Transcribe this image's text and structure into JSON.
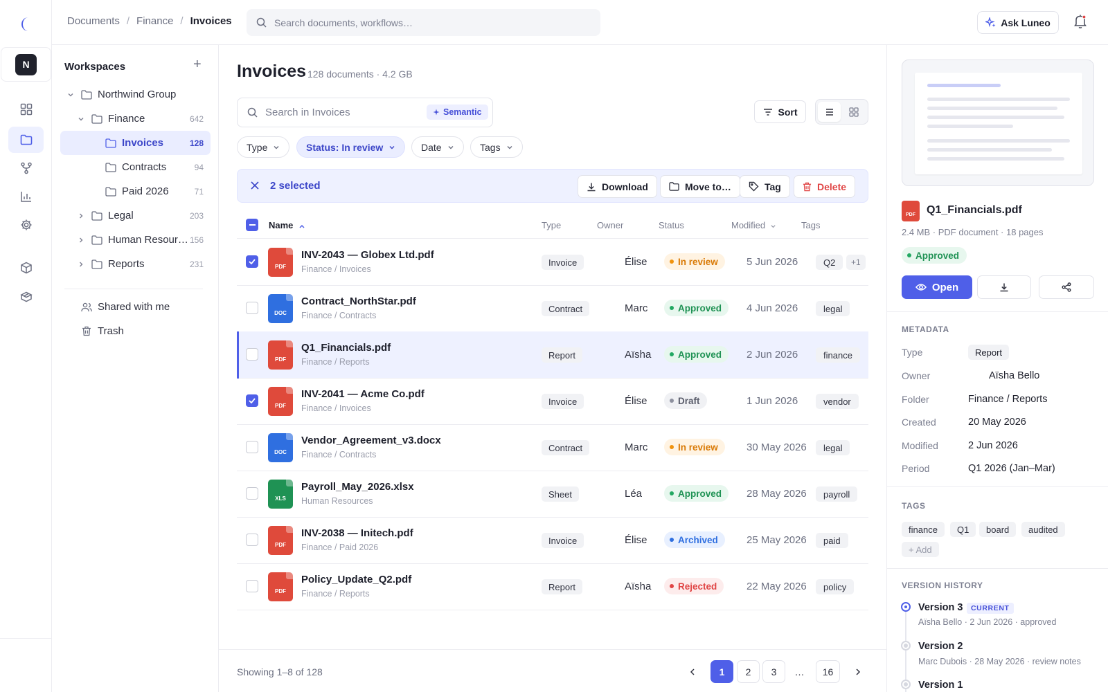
{
  "rail": {
    "avatar_initial": "N",
    "icons": [
      "grid-icon",
      "folder-icon",
      "workflow-icon",
      "chart-icon",
      "gear-icon",
      "cube-icon",
      "box-icon"
    ]
  },
  "topbar": {
    "breadcrumb": [
      "Documents",
      "Finance",
      "Invoices"
    ],
    "breadcrumb_sep": "/",
    "search_placeholder": "Search documents, workflows…",
    "ask_label": "Ask Luneo"
  },
  "workspaces": {
    "title": "Workspaces",
    "add": "+",
    "tree": [
      {
        "label": "Northwind Group",
        "count": ""
      },
      {
        "label": "Finance",
        "count": "642"
      },
      {
        "label": "Invoices",
        "count": "128"
      },
      {
        "label": "Contracts",
        "count": "94"
      },
      {
        "label": "Paid 2026",
        "count": "71"
      },
      {
        "label": "Legal",
        "count": "203"
      },
      {
        "label": "Human Resour…",
        "count": "156"
      },
      {
        "label": "Reports",
        "count": "231"
      }
    ],
    "shared": "Shared with me",
    "trash": "Trash"
  },
  "main": {
    "title": "Invoices",
    "subtitle": "128 documents · 4.2 GB",
    "search_placeholder": "Search in Invoices",
    "semantic_label": "Semantic",
    "sort_label": "Sort",
    "filters": [
      "Type",
      "Status: In review",
      "Date",
      "Tags"
    ],
    "selection": {
      "count_label": "2 selected",
      "actions": [
        "Download",
        "Move to…",
        "Tag",
        "Delete"
      ]
    },
    "columns": [
      "Name",
      "Type",
      "Owner",
      "Status",
      "Modified",
      "Tags"
    ],
    "rows": [
      {
        "name": "INV-2043 — Globex Ltd.pdf",
        "path": "Finance / Invoices",
        "ext": "PDF",
        "type": "Invoice",
        "owner": "Élise",
        "status": "In review",
        "modified": "5 Jun 2026",
        "tag": "Q2",
        "tag_extra": "+1",
        "checked": true
      },
      {
        "name": "Contract_NorthStar.pdf",
        "path": "Finance / Contracts",
        "ext": "DOC",
        "type": "Contract",
        "owner": "Marc",
        "status": "Approved",
        "modified": "4 Jun 2026",
        "tag": "legal",
        "tag_extra": "",
        "checked": false
      },
      {
        "name": "Q1_Financials.pdf",
        "path": "Finance / Reports",
        "ext": "PDF",
        "type": "Report",
        "owner": "Aïsha",
        "status": "Approved",
        "modified": "2 Jun 2026",
        "tag": "finance",
        "tag_extra": "",
        "checked": false
      },
      {
        "name": "INV-2041 — Acme Co.pdf",
        "path": "Finance / Invoices",
        "ext": "PDF",
        "type": "Invoice",
        "owner": "Élise",
        "status": "Draft",
        "modified": "1 Jun 2026",
        "tag": "vendor",
        "tag_extra": "",
        "checked": true
      },
      {
        "name": "Vendor_Agreement_v3.docx",
        "path": "Finance / Contracts",
        "ext": "DOC",
        "type": "Contract",
        "owner": "Marc",
        "status": "In review",
        "modified": "30 May 2026",
        "tag": "legal",
        "tag_extra": "",
        "checked": false
      },
      {
        "name": "Payroll_May_2026.xlsx",
        "path": "Human Resources",
        "ext": "XLS",
        "type": "Sheet",
        "owner": "Léa",
        "status": "Approved",
        "modified": "28 May 2026",
        "tag": "payroll",
        "tag_extra": "",
        "checked": false
      },
      {
        "name": "INV-2038 — Initech.pdf",
        "path": "Finance / Paid 2026",
        "ext": "PDF",
        "type": "Invoice",
        "owner": "Élise",
        "status": "Archived",
        "modified": "25 May 2026",
        "tag": "paid",
        "tag_extra": "",
        "checked": false
      },
      {
        "name": "Policy_Update_Q2.pdf",
        "path": "Finance / Reports",
        "ext": "PDF",
        "type": "Report",
        "owner": "Aïsha",
        "status": "Rejected",
        "modified": "22 May 2026",
        "tag": "policy",
        "tag_extra": "",
        "checked": false
      }
    ],
    "showing": "Showing 1–8 of 128",
    "pages": [
      "1",
      "2",
      "3",
      "…",
      "16"
    ]
  },
  "details": {
    "ext": "PDF",
    "file_name": "Q1_Financials.pdf",
    "meta": "2.4 MB · PDF document · 18 pages",
    "status": "Approved",
    "open_label": "Open",
    "metadata_title": "METADATA",
    "metadata": [
      {
        "k": "Type",
        "v": "Report"
      },
      {
        "k": "Owner",
        "v": "Aïsha Bello"
      },
      {
        "k": "Folder",
        "v": "Finance / Reports"
      },
      {
        "k": "Created",
        "v": "20 May 2026"
      },
      {
        "k": "Modified",
        "v": "2 Jun 2026"
      },
      {
        "k": "Period",
        "v": "Q1 2026 (Jan–Mar)"
      }
    ],
    "tags_title": "TAGS",
    "tags": [
      "finance",
      "Q1",
      "board",
      "audited"
    ],
    "add_tag": "+ Add",
    "history_title": "VERSION HISTORY",
    "current_label": "CURRENT",
    "versions": [
      {
        "title": "Version 3",
        "sub": "Aïsha Bello · 2 Jun 2026 · approved"
      },
      {
        "title": "Version 2",
        "sub": "Marc Dubois · 28 May 2026 · review notes"
      },
      {
        "title": "Version 1",
        "sub": ""
      }
    ]
  },
  "colors": {
    "accent": "#4f5fe8",
    "pdf": "#df4a3b",
    "doc": "#2f6fe0",
    "xls": "#1f9254",
    "in_review": "#d97a06",
    "approved": "#1f9254",
    "draft": "#5a5d6b",
    "archived": "#2f6fe0",
    "rejected": "#e04545"
  }
}
